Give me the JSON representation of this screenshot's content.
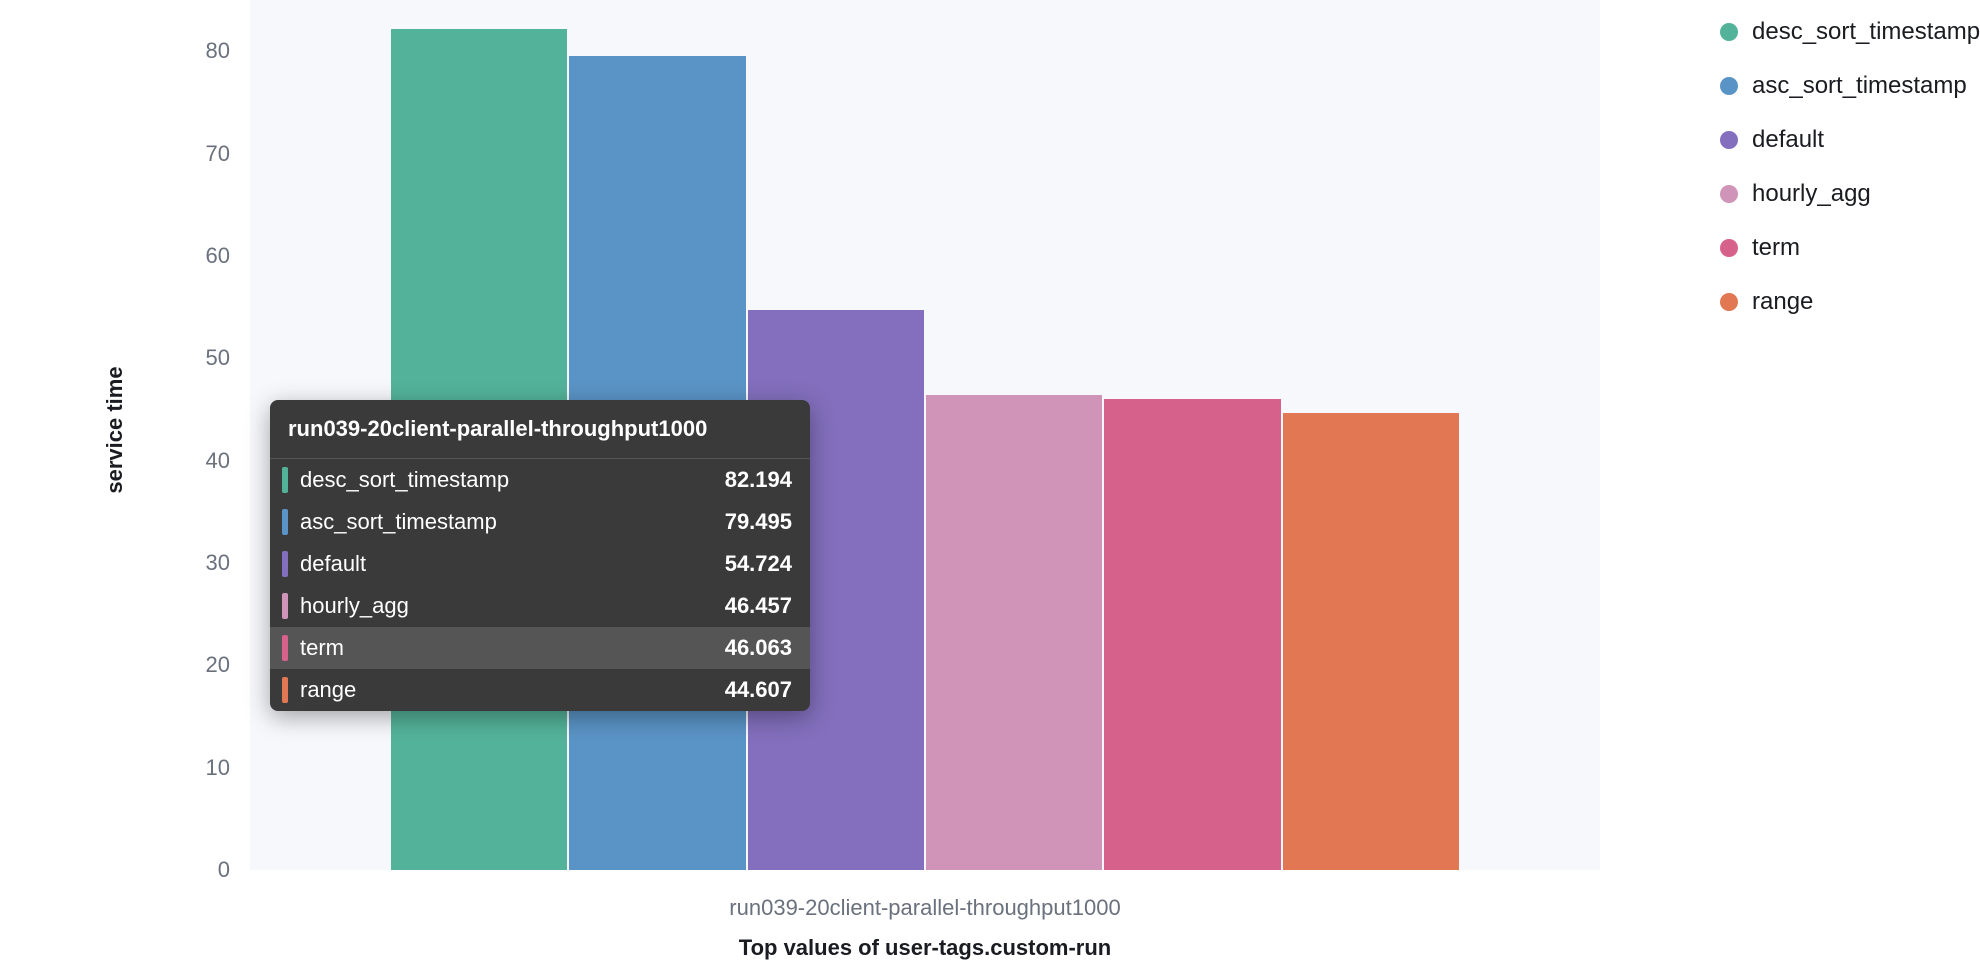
{
  "chart_data": {
    "type": "bar",
    "title": "",
    "xlabel": "Top values of user-tags.custom-run",
    "ylabel": "service time",
    "ylim": [
      0,
      85
    ],
    "yticks": [
      0,
      10,
      20,
      30,
      40,
      50,
      60,
      70,
      80
    ],
    "categories": [
      "run039-20client-parallel-throughput1000"
    ],
    "series": [
      {
        "name": "desc_sort_timestamp",
        "values": [
          82.194
        ],
        "color": "#53b39a"
      },
      {
        "name": "asc_sort_timestamp",
        "values": [
          79.495
        ],
        "color": "#5a94c6"
      },
      {
        "name": "default",
        "values": [
          54.724
        ],
        "color": "#836fbd"
      },
      {
        "name": "hourly_agg",
        "values": [
          46.457
        ],
        "color": "#cf94b7"
      },
      {
        "name": "term",
        "values": [
          46.063
        ],
        "color": "#d6618a"
      },
      {
        "name": "range",
        "values": [
          44.607
        ],
        "color": "#e27754"
      }
    ]
  },
  "tooltip": {
    "title": "run039-20client-parallel-throughput1000",
    "highlight_index": 4,
    "rows": [
      {
        "name": "desc_sort_timestamp",
        "value": "82.194",
        "color": "#53b39a"
      },
      {
        "name": "asc_sort_timestamp",
        "value": "79.495",
        "color": "#5a94c6"
      },
      {
        "name": "default",
        "value": "54.724",
        "color": "#836fbd"
      },
      {
        "name": "hourly_agg",
        "value": "46.457",
        "color": "#cf94b7"
      },
      {
        "name": "term",
        "value": "46.063",
        "color": "#d6618a"
      },
      {
        "name": "range",
        "value": "44.607",
        "color": "#e27754"
      }
    ]
  }
}
